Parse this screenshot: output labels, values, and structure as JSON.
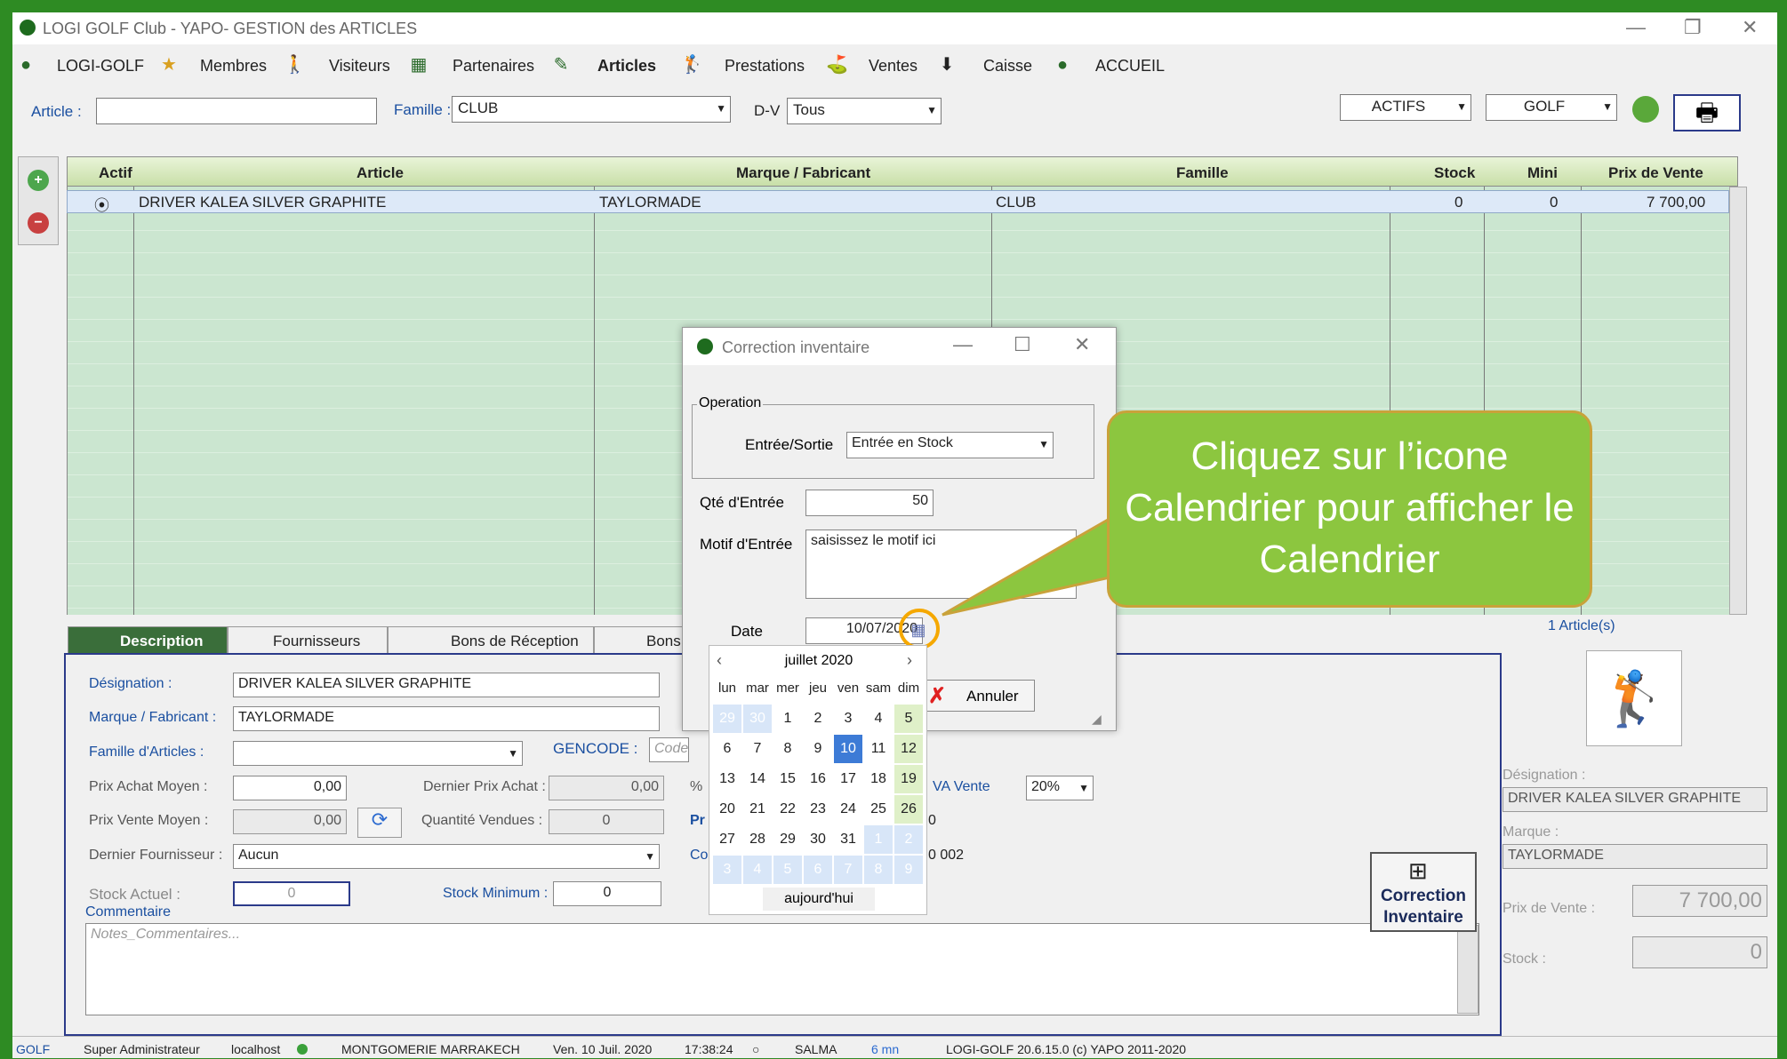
{
  "window": {
    "title": "LOGI GOLF Club - YAPO- GESTION des ARTICLES",
    "minimize": "—",
    "restore": "❐",
    "close": "✕"
  },
  "menu": [
    {
      "label": "LOGI-GOLF",
      "icon": "golf-ball-icon"
    },
    {
      "label": "Membres",
      "icon": "members-icon"
    },
    {
      "label": "Visiteurs",
      "icon": "walker-icon"
    },
    {
      "label": "Partenaires",
      "icon": "partners-icon"
    },
    {
      "label": "Articles",
      "icon": "articles-icon"
    },
    {
      "label": "Prestations",
      "icon": "golfer-icon"
    },
    {
      "label": "Ventes",
      "icon": "sales-icon"
    },
    {
      "label": "Caisse",
      "icon": "download-icon"
    },
    {
      "label": "ACCUEIL",
      "icon": "home-ball-icon"
    }
  ],
  "filters": {
    "article_label": "Article :",
    "article_value": "",
    "famille_label": "Famille :",
    "famille_value": "CLUB",
    "dv_label": "D-V",
    "dv_value": "Tous",
    "actifs": "ACTIFS",
    "golf": "GOLF"
  },
  "grid": {
    "headers": [
      "Actif",
      "Article",
      "Marque / Fabricant",
      "Famille",
      "Stock",
      "Mini",
      "Prix de Vente"
    ],
    "rows": [
      {
        "actif": "⦿",
        "article": "DRIVER KALEA SILVER GRAPHITE",
        "marque": "TAYLORMADE",
        "famille": "CLUB",
        "stock": "0",
        "mini": "0",
        "prix": "7 700,00"
      }
    ],
    "count": "1 Article(s)"
  },
  "tabs": [
    "Description",
    "Fournisseurs",
    "Bons de Réception",
    "Bons"
  ],
  "form": {
    "designation_label": "Désignation :",
    "designation": "DRIVER KALEA SILVER GRAPHITE",
    "marque_label": "Marque / Fabricant :",
    "marque": "TAYLORMADE",
    "famille_label": "Famille d'Articles :",
    "famille": "",
    "gencode_label": "GENCODE :",
    "gencode_placeholder": "Code bar",
    "pam_label": "Prix Achat Moyen :",
    "pam": "0,00",
    "dpa_label": "Dernier Prix Achat :",
    "dpa": "0,00",
    "pvm_label": "Prix Vente Moyen :",
    "pvm": "0,00",
    "qv_label": "Quantité Vendues :",
    "qv": "0",
    "df_label": "Dernier Fournisseur :",
    "df": "Aucun",
    "sa_label": "Stock Actuel :",
    "sa": "0",
    "smin_label": "Stock Minimum :",
    "smin": "0",
    "comment_label": "Commentaire",
    "comment_placeholder": "Notes_Commentaires...",
    "tva_label": "VA Vente",
    "tva": "20%",
    "pct": "%",
    "pr": "Pr",
    "co": "Co",
    "code_002": "0 002",
    "code_0": "0"
  },
  "correction_button": "Correction Inventaire",
  "right_panel": {
    "designation_label": "Désignation :",
    "designation": "DRIVER KALEA SILVER GRAPHITE",
    "marque_label": "Marque :",
    "marque": "TAYLORMADE",
    "prix_label": "Prix de Vente :",
    "prix": "7 700,00",
    "stock_label": "Stock :",
    "stock": "0"
  },
  "dialog": {
    "title": "Correction inventaire",
    "operation_label": "Operation",
    "es_label": "Entrée/Sortie",
    "es_value": "Entrée en Stock",
    "qte_label": "Qté d'Entrée",
    "qte": "50",
    "motif_label": "Motif d'Entrée",
    "motif": "saisissez le motif ici",
    "date_label": "Date",
    "date": "10/07/2020",
    "annuler": "Annuler"
  },
  "calendar": {
    "month": "juillet 2020",
    "days": [
      "lun",
      "mar",
      "mer",
      "jeu",
      "ven",
      "sam",
      "dim"
    ],
    "cells": [
      "29",
      "30",
      "1",
      "2",
      "3",
      "4",
      "5",
      "6",
      "7",
      "8",
      "9",
      "10",
      "11",
      "12",
      "13",
      "14",
      "15",
      "16",
      "17",
      "18",
      "19",
      "20",
      "21",
      "22",
      "23",
      "24",
      "25",
      "26",
      "27",
      "28",
      "29",
      "30",
      "31",
      "1",
      "2",
      "3",
      "4",
      "5",
      "6",
      "7",
      "8",
      "9"
    ],
    "selected": "10",
    "today_label": "aujourd'hui"
  },
  "callout": "Cliquez sur l’icone Calendrier pour afficher le Calendrier",
  "status": {
    "app": "GOLF",
    "user": "Super Administrateur",
    "host": "localhost",
    "club": "MONTGOMERIE MARRAKECH",
    "date": "Ven. 10 Juil. 2020",
    "time": "17:38:24",
    "name": "SALMA",
    "duration": "6 mn",
    "version": "LOGI-GOLF 20.6.15.0  (c) YAPO 2011-2020"
  },
  "colors": {
    "accent_green": "#8cc63f",
    "selected_day": "#3d7bd6",
    "grid_row": "#cbe6d0",
    "border_blue": "#2b3a8a"
  }
}
